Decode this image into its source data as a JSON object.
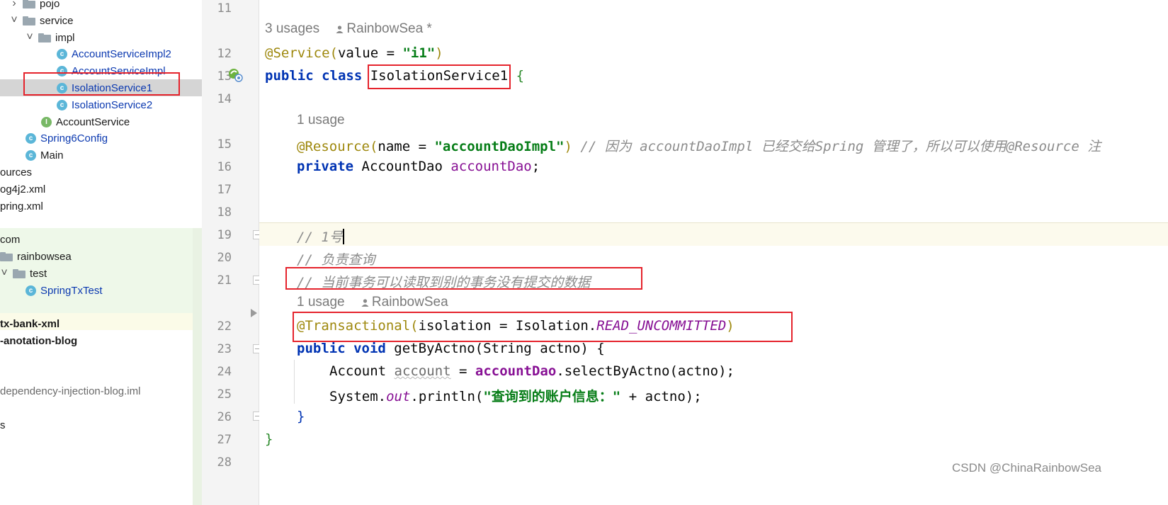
{
  "tree": {
    "items": [
      {
        "label": "pojo",
        "kind": "folder",
        "indent": 1,
        "chevron": "right"
      },
      {
        "label": "service",
        "kind": "folder",
        "indent": 1,
        "chevron": "down"
      },
      {
        "label": "impl",
        "kind": "folder",
        "indent": 2,
        "chevron": "down"
      },
      {
        "label": "AccountServiceImpl2",
        "kind": "class",
        "indent": 3
      },
      {
        "label": "AccountServiceImpl",
        "kind": "class",
        "indent": 3
      },
      {
        "label": "IsolationService1",
        "kind": "class",
        "indent": 3,
        "selected": true
      },
      {
        "label": "IsolationService2",
        "kind": "class",
        "indent": 3
      },
      {
        "label": "AccountService",
        "kind": "interface",
        "indent": 2
      },
      {
        "label": "Spring6Config",
        "kind": "class",
        "indent": 1
      },
      {
        "label": "Main",
        "kind": "main",
        "indent": 1
      },
      {
        "label": "ources",
        "kind": "text",
        "indent": 0
      },
      {
        "label": "og4j2.xml",
        "kind": "text",
        "indent": 0
      },
      {
        "label": "pring.xml",
        "kind": "text",
        "indent": 0
      },
      {
        "label": "",
        "kind": "blank",
        "indent": 0
      },
      {
        "label": "com",
        "kind": "text",
        "indent": 0
      },
      {
        "label": "rainbowsea",
        "kind": "folder-cut",
        "indent": 0
      },
      {
        "label": "test",
        "kind": "folder",
        "indent": 0,
        "chevron": "down"
      },
      {
        "label": "SpringTxTest",
        "kind": "test",
        "indent": 1
      },
      {
        "label": "",
        "kind": "blank",
        "indent": 0
      },
      {
        "label": "tx-bank-xml",
        "kind": "bold",
        "indent": 0
      },
      {
        "label": "-anotation-blog",
        "kind": "bold",
        "indent": 0
      },
      {
        "label": "",
        "kind": "blank",
        "indent": 0
      },
      {
        "label": "",
        "kind": "blank",
        "indent": 0
      },
      {
        "label": "dependency-injection-blog.iml",
        "kind": "gray",
        "indent": 0
      },
      {
        "label": "",
        "kind": "blank",
        "indent": 0
      },
      {
        "label": "s",
        "kind": "text",
        "indent": 0
      }
    ]
  },
  "gutter": {
    "line_numbers": [
      "11",
      "12",
      "13",
      "14",
      "15",
      "16",
      "17",
      "18",
      "19",
      "20",
      "21",
      "22",
      "23",
      "24",
      "25",
      "26",
      "27",
      "28"
    ]
  },
  "editor": {
    "hint_class": {
      "usages": "3 usages",
      "author": "RainbowSea *"
    },
    "hint_field": {
      "usages": "1 usage"
    },
    "hint_method": {
      "usages": "1 usage",
      "author": "RainbowSea"
    },
    "l12": {
      "ann": "@Service(",
      "plain1": "value = ",
      "str": "\"i1\"",
      "plain2": ")"
    },
    "l13": {
      "kw": "public class ",
      "name": "IsolationService1",
      "brace": " {"
    },
    "l15": {
      "ann": "@Resource(",
      "plain1": "name = ",
      "str": "\"accountDaoImpl\"",
      "plain2": ") ",
      "cmt": "// 因为 accountDaoImpl 已经交给Spring 管理了，所以可以使用@Resource 注"
    },
    "l16": {
      "kw": "private ",
      "type": "AccountDao ",
      "field": "accountDao",
      "semi": ";"
    },
    "l19": {
      "cmt": "// 1号"
    },
    "l20": {
      "cmt": "// 负责查询"
    },
    "l21": {
      "cmt": "// 当前事务可以读取到别的事务没有提交的数据"
    },
    "l22": {
      "ann": "@Transactional(",
      "plain1": "isolation = Isolation.",
      "static": "READ_UNCOMMITTED",
      "ann2": ")"
    },
    "l23": {
      "kw": "public void ",
      "plain1": "getByActno(String ",
      "param": "actno",
      "plain2": ") {"
    },
    "l24": {
      "plain1": "Account ",
      "local": "account",
      "plain2": " = ",
      "field": "accountDao",
      "plain3": ".selectByActno(actno);"
    },
    "l25": {
      "plain1": "System.",
      "static": "out",
      "plain2": ".println(",
      "str": "\"查询到的账户信息：\"",
      "plain3": " + actno);"
    },
    "l26": {
      "plain": "}"
    },
    "l27": {
      "brace": "}"
    }
  },
  "watermark": "CSDN @ChinaRainbowSea",
  "colors": {
    "highlight_box": "#e5232c",
    "keyword": "#0033b3",
    "annotation": "#9e880d",
    "string": "#067d17",
    "comment": "#8c8c8c",
    "field": "#871094"
  }
}
